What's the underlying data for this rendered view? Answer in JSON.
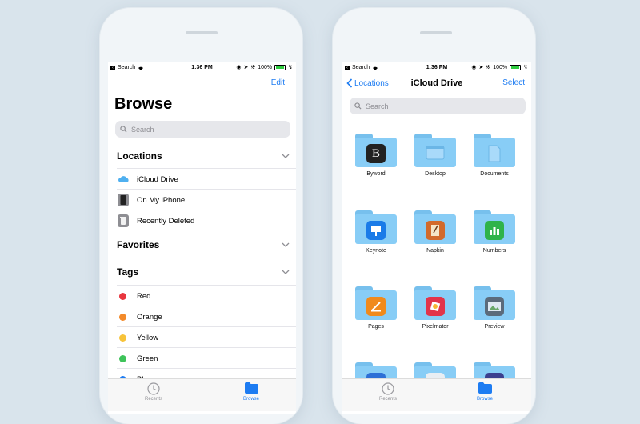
{
  "status": {
    "carrier": "Search",
    "time": "1:36 PM",
    "battery": "100%"
  },
  "left": {
    "edit_label": "Edit",
    "title": "Browse",
    "search_placeholder": "Search",
    "locations": {
      "header": "Locations",
      "items": [
        {
          "label": "iCloud Drive",
          "icon": "icloud-icon"
        },
        {
          "label": "On My iPhone",
          "icon": "iphone-icon"
        },
        {
          "label": "Recently Deleted",
          "icon": "trash-icon"
        }
      ]
    },
    "favorites": {
      "header": "Favorites"
    },
    "tags": {
      "header": "Tags",
      "items": [
        {
          "label": "Red",
          "color": "#e8363f"
        },
        {
          "label": "Orange",
          "color": "#f38a2a"
        },
        {
          "label": "Yellow",
          "color": "#f7c33a"
        },
        {
          "label": "Green",
          "color": "#3ec35a"
        },
        {
          "label": "Blue",
          "color": "#1d7cf2"
        }
      ]
    }
  },
  "right": {
    "back_label": "Locations",
    "title": "iCloud Drive",
    "select_label": "Select",
    "search_placeholder": "Search",
    "folders": [
      {
        "name": "Byword",
        "icon": "byword-icon"
      },
      {
        "name": "Desktop",
        "icon": "desktop-icon"
      },
      {
        "name": "Documents",
        "icon": "documents-icon"
      },
      {
        "name": "Keynote",
        "icon": "keynote-icon"
      },
      {
        "name": "Napkin",
        "icon": "napkin-icon"
      },
      {
        "name": "Numbers",
        "icon": "numbers-icon"
      },
      {
        "name": "Pages",
        "icon": "pages-icon"
      },
      {
        "name": "Pixelmator",
        "icon": "pixelmator-icon"
      },
      {
        "name": "Preview",
        "icon": "preview-icon"
      }
    ]
  },
  "tabbar": {
    "recents": "Recents",
    "browse": "Browse"
  },
  "colors": {
    "accent": "#1d7cf2",
    "folder": "#88cdf6"
  }
}
